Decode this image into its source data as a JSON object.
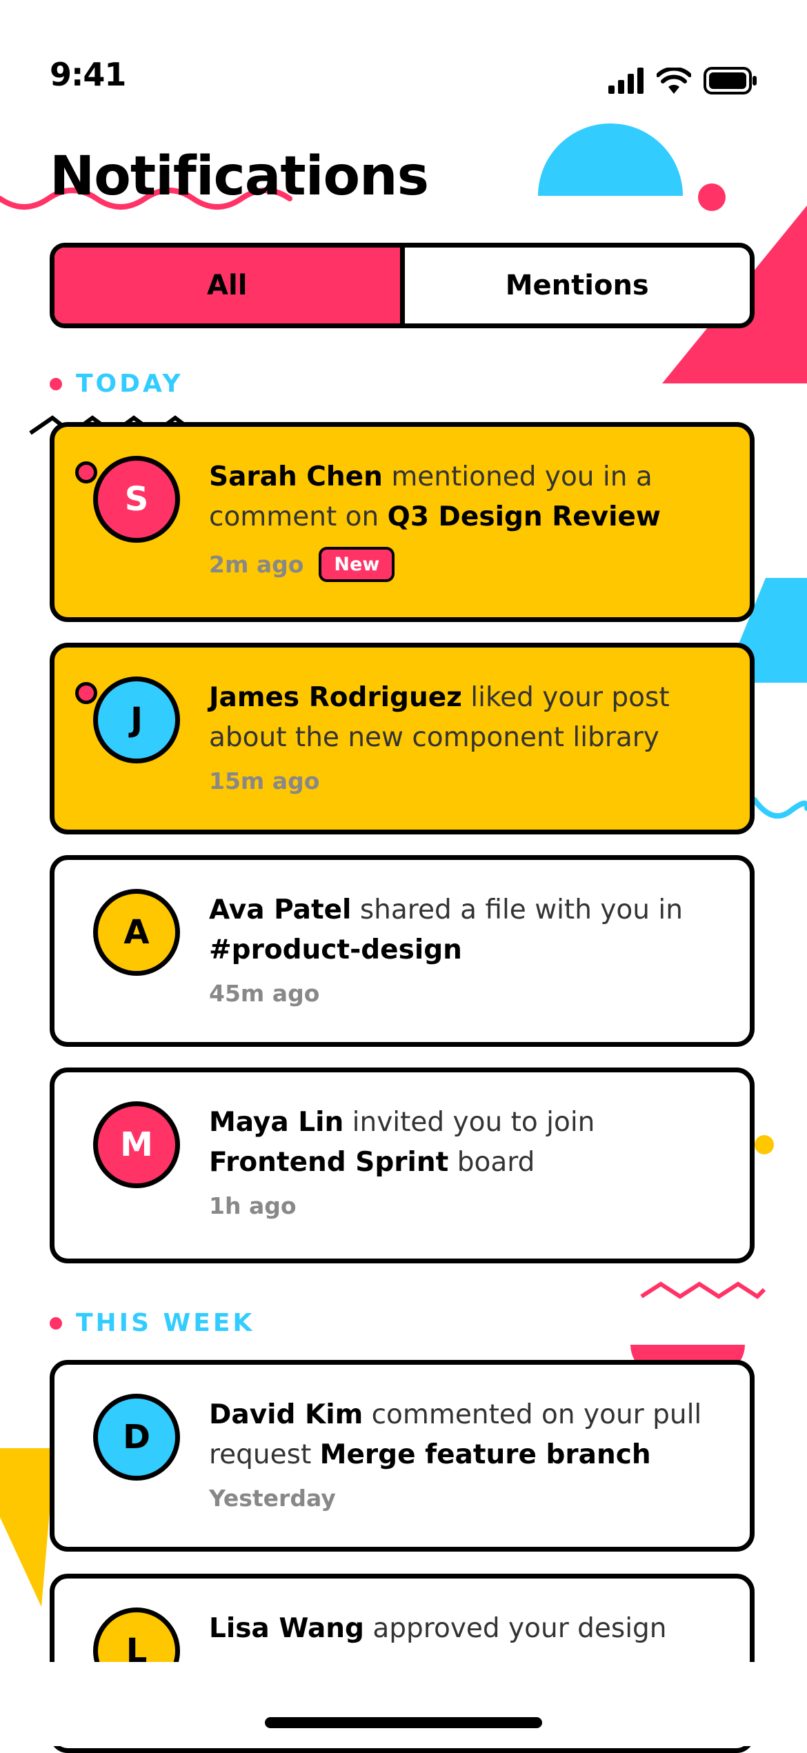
{
  "status_bar": {
    "time": "9:41"
  },
  "header": {
    "title": "Notifications"
  },
  "tabs": [
    {
      "label": "All",
      "active": true
    },
    {
      "label": "Mentions",
      "active": false
    }
  ],
  "sections": [
    {
      "label": "TODAY"
    },
    {
      "label": "THIS WEEK"
    }
  ],
  "notifications": [
    {
      "initial": "S",
      "name": "Sarah Chen",
      "action": "mentioned you in a comment on",
      "target": "Q3 Design Review",
      "suffix": "",
      "time": "2m ago",
      "badge": "New",
      "unread": true,
      "avatar_color": "#FF3366"
    },
    {
      "initial": "J",
      "name": "James Rodriguez",
      "action": "liked your post about the new component library",
      "target": "",
      "suffix": "",
      "time": "15m ago",
      "unread": true,
      "avatar_color": "#33CCFF"
    },
    {
      "initial": "A",
      "name": "Ava Patel",
      "action": "shared a file with you in",
      "target": "#product-design",
      "suffix": "",
      "time": "45m ago",
      "unread": false,
      "avatar_color": "#FFC700"
    },
    {
      "initial": "M",
      "name": "Maya Lin",
      "action": "invited you to join",
      "target": "Frontend Sprint",
      "suffix": "board",
      "time": "1h ago",
      "unread": false,
      "avatar_color": "#FF3366"
    },
    {
      "initial": "D",
      "name": "David Kim",
      "action": "commented on your pull request",
      "target": "Merge feature branch",
      "suffix": "",
      "time": "Yesterday",
      "unread": false,
      "avatar_color": "#33CCFF"
    },
    {
      "initial": "L",
      "name": "Lisa Wang",
      "action": "approved your design",
      "target": "",
      "suffix": "",
      "time": "",
      "unread": false,
      "avatar_color": "#FFC700"
    }
  ],
  "colors": {
    "pink": "#FF3366",
    "yellow": "#FFC700",
    "cyan": "#33CCFF"
  }
}
